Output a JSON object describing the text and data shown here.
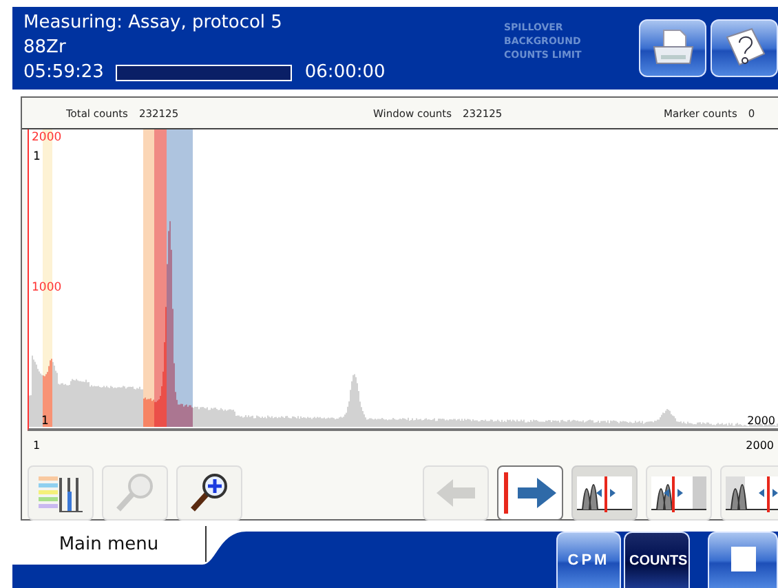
{
  "header": {
    "title": "Measuring: Assay, protocol 5",
    "nuclide": "88Zr",
    "elapsed": "05:59:23",
    "progress": {
      "level": 0.998
    },
    "total_time": "06:00:00",
    "indicators": [
      {
        "label": "SPILLOVER",
        "on": false
      },
      {
        "label": "BACKGROUND",
        "on": false
      },
      {
        "label": "COUNTS LIMIT",
        "on": false
      }
    ],
    "buttons": [
      {
        "kind": "print"
      },
      {
        "kind": "help"
      }
    ]
  },
  "counts": [
    {
      "label": "Total counts",
      "value": "232125"
    },
    {
      "label": "Window counts",
      "value": "232125"
    },
    {
      "label": "Marker counts",
      "value": "0"
    }
  ],
  "spectrum": {
    "y_top_label": "2000",
    "y_mid_label": "1000",
    "top_left_label": "1",
    "bottom_left_label": "1",
    "bottom_right_label": "2000",
    "windows": [
      {
        "color": "#fdf2d4"
      },
      {
        "color": "#fbd6b6"
      },
      {
        "color": "#f08a84"
      },
      {
        "color": "#aec4df"
      }
    ]
  },
  "axis": {
    "start": "1",
    "end": "2000"
  },
  "toolbar": [
    {
      "kind": "legend",
      "disabled": false,
      "selected": false,
      "focused": false
    },
    {
      "kind": "zoom",
      "disabled": true,
      "selected": false,
      "focused": false
    },
    {
      "kind": "zoom_in",
      "disabled": false,
      "selected": false,
      "focused": false
    },
    {
      "kind": "prev",
      "disabled": true,
      "selected": false,
      "focused": false
    },
    {
      "kind": "next",
      "disabled": false,
      "selected": false,
      "focused": true
    },
    {
      "kind": "view_left",
      "disabled": false,
      "selected": true,
      "focused": false
    },
    {
      "kind": "view_mid",
      "disabled": false,
      "selected": false,
      "focused": false
    },
    {
      "kind": "view_right",
      "disabled": false,
      "selected": false,
      "focused": false
    }
  ],
  "footer": {
    "tab": "Main menu",
    "modes": [
      {
        "label": "CPM",
        "selected": false
      },
      {
        "label": "COUNTS",
        "selected": true
      }
    ]
  }
}
